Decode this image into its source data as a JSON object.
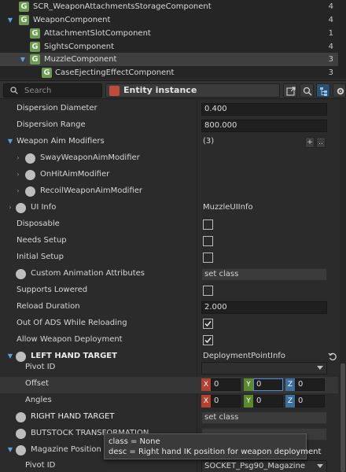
{
  "tree": {
    "rows": [
      {
        "label": "SCR_WeaponAttachmentsStorageComponent",
        "count": "4"
      },
      {
        "label": "WeaponComponent",
        "count": "4"
      },
      {
        "label": "AttachmentSlotComponent",
        "count": "1"
      },
      {
        "label": "SightsComponent",
        "count": "4"
      },
      {
        "label": "MuzzleComponent",
        "count": "3"
      },
      {
        "label": "CaseEjectingEffectComponent",
        "count": "3"
      }
    ]
  },
  "toolbar": {
    "search_placeholder": "Search",
    "entity_label": "Entity instance"
  },
  "props": {
    "dispersion_diameter": {
      "label": "Dispersion Diameter",
      "value": "0.400"
    },
    "dispersion_range": {
      "label": "Dispersion Range",
      "value": "800.000"
    },
    "weapon_aim_modifiers": {
      "label": "Weapon Aim Modifiers",
      "value": "(3)",
      "add": "+",
      "more": ".."
    },
    "sway_modifier": {
      "label": "SwayWeaponAimModifier"
    },
    "onhit_modifier": {
      "label": "OnHitAimModifier"
    },
    "recoil_modifier": {
      "label": "RecoilWeaponAimModifier"
    },
    "ui_info": {
      "label": "UI Info",
      "value": "MuzzleUIInfo"
    },
    "disposable": {
      "label": "Disposable",
      "checked": false
    },
    "needs_setup": {
      "label": "Needs Setup",
      "checked": false
    },
    "initial_setup": {
      "label": "Initial Setup",
      "checked": false
    },
    "custom_anim_attrs": {
      "label": "Custom Animation Attributes",
      "value": "set class"
    },
    "supports_lowered": {
      "label": "Supports Lowered",
      "checked": false
    },
    "reload_duration": {
      "label": "Reload Duration",
      "value": "2.000"
    },
    "out_of_ads": {
      "label": "Out Of ADS While Reloading",
      "checked": true
    },
    "allow_deployment": {
      "label": "Allow Weapon Deployment",
      "checked": true
    },
    "left_hand_target": {
      "label": "LEFT HAND TARGET",
      "value": "DeploymentPointInfo"
    },
    "pivot_id": {
      "label": "Pivot ID",
      "value": ""
    },
    "offset": {
      "label": "Offset",
      "x_tag": "X",
      "x": "0",
      "y_tag": "Y",
      "y": "0",
      "z_tag": "Z",
      "z": "0"
    },
    "angles": {
      "label": "Angles",
      "x_tag": "X",
      "x": "0",
      "y_tag": "Y",
      "y": "0",
      "z_tag": "Z",
      "z": "0"
    },
    "right_hand_target": {
      "label": "RIGHT HAND TARGET",
      "value": "set class"
    },
    "buttstock_transformation": {
      "label": "BUTSTOCK TRANSFORMATION"
    },
    "magazine_position": {
      "label": "Magazine Position"
    },
    "magazine_pivot_id": {
      "label": "Pivot ID",
      "value": "SOCKET_Psg90_Magazine"
    }
  },
  "tooltip": {
    "line1": "class = None",
    "line2": "desc = Right hand IK position for weapon deployment"
  },
  "colors": {
    "accent_blue": "#5aa3e6",
    "component_green": "#6f9a53",
    "entity_red": "#c04a3c"
  }
}
